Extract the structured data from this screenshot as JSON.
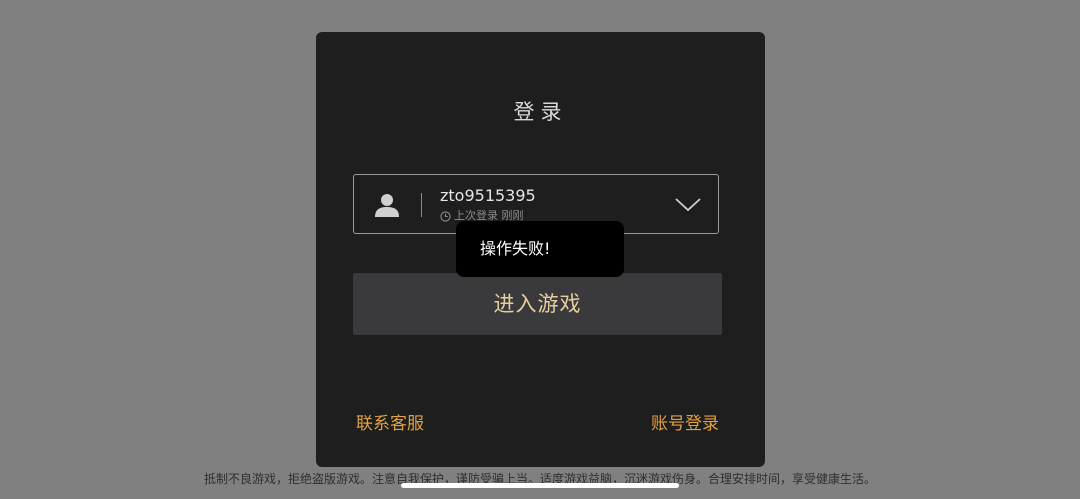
{
  "dialog": {
    "title": "登录",
    "account": {
      "username": "zto9515395",
      "last_login_label": "上次登录 刚刚",
      "avatar_icon": "person-icon",
      "dropdown_icon": "chevron-down-icon"
    },
    "enter_button_label": "进入游戏",
    "contact_service_label": "联系客服",
    "account_login_label": "账号登录"
  },
  "toast": {
    "message": "操作失败!"
  },
  "footer": {
    "notice": "抵制不良游戏，拒绝盗版游戏。注意自我保护，谨防受骗上当。适度游戏益脑，沉迷游戏伤身。合理安排时间，享受健康生活。"
  },
  "colors": {
    "overlay": "#808080",
    "dialog_bg": "#1e1e1e",
    "button_bg": "#3a3a3d",
    "button_text": "#e7cf9c",
    "link": "#e2a043"
  }
}
